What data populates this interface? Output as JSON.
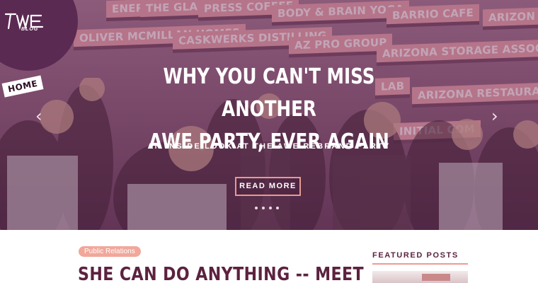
{
  "hero": {
    "logo_text": "BLOG",
    "home_badge": "HOME",
    "signs": [
      "ENER",
      "THE GLADLY",
      "PRESS COFFEE",
      "BODY & BRAIN YOGA",
      "BARRIO CAFE",
      "ARIZON",
      "OLIVER MCMILLAN HOMES",
      "CASKWERKS DISTILLING",
      "AZ PRO GROUP",
      "ARIZONA STORAGE ASSOC",
      "ARIZONA RESTAURA",
      "LAB",
      "INITIAL COM"
    ],
    "title_line1": "WHY YOU CAN'T MISS ANOTHER",
    "title_line2": "AWE PARTY, EVER AGAIN",
    "subtitle": "AN INSIDE LOOK AT THE AWE REBRAND PARTY",
    "read_more": "READ MORE",
    "prev_arrow": "‹",
    "next_arrow": "›",
    "slides": 4
  },
  "article": {
    "tag": "Public Relations",
    "title": "SHE CAN DO ANYTHING -- MEET"
  },
  "sidebar": {
    "featured_heading": "FEATURED POSTS"
  },
  "colors": {
    "accent": "#f1a79a",
    "brand": "#5c2240",
    "logo_bg": "#5b2a52"
  }
}
